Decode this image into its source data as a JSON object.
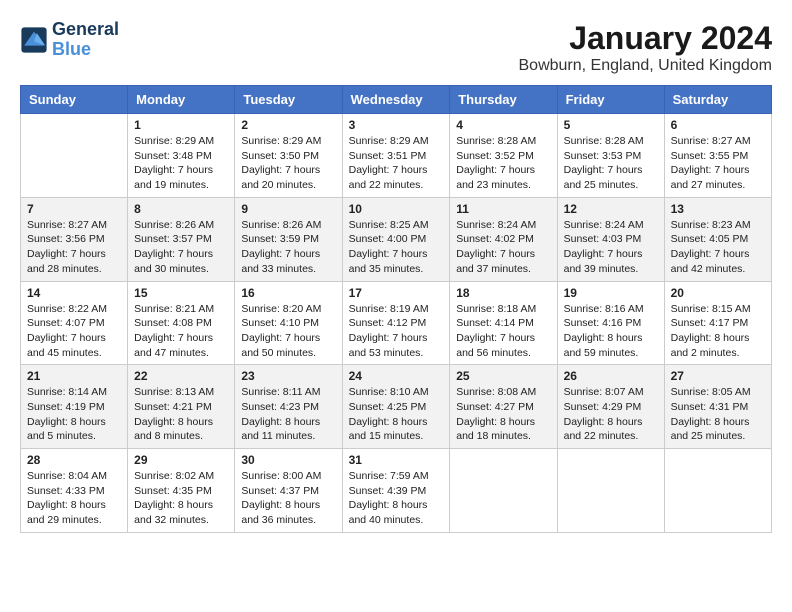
{
  "logo": {
    "line1": "General",
    "line2": "Blue"
  },
  "title": "January 2024",
  "subtitle": "Bowburn, England, United Kingdom",
  "header": {
    "days": [
      "Sunday",
      "Monday",
      "Tuesday",
      "Wednesday",
      "Thursday",
      "Friday",
      "Saturday"
    ]
  },
  "weeks": [
    [
      {
        "day": "",
        "info": ""
      },
      {
        "day": "1",
        "info": "Sunrise: 8:29 AM\nSunset: 3:48 PM\nDaylight: 7 hours\nand 19 minutes."
      },
      {
        "day": "2",
        "info": "Sunrise: 8:29 AM\nSunset: 3:50 PM\nDaylight: 7 hours\nand 20 minutes."
      },
      {
        "day": "3",
        "info": "Sunrise: 8:29 AM\nSunset: 3:51 PM\nDaylight: 7 hours\nand 22 minutes."
      },
      {
        "day": "4",
        "info": "Sunrise: 8:28 AM\nSunset: 3:52 PM\nDaylight: 7 hours\nand 23 minutes."
      },
      {
        "day": "5",
        "info": "Sunrise: 8:28 AM\nSunset: 3:53 PM\nDaylight: 7 hours\nand 25 minutes."
      },
      {
        "day": "6",
        "info": "Sunrise: 8:27 AM\nSunset: 3:55 PM\nDaylight: 7 hours\nand 27 minutes."
      }
    ],
    [
      {
        "day": "7",
        "info": "Sunrise: 8:27 AM\nSunset: 3:56 PM\nDaylight: 7 hours\nand 28 minutes."
      },
      {
        "day": "8",
        "info": "Sunrise: 8:26 AM\nSunset: 3:57 PM\nDaylight: 7 hours\nand 30 minutes."
      },
      {
        "day": "9",
        "info": "Sunrise: 8:26 AM\nSunset: 3:59 PM\nDaylight: 7 hours\nand 33 minutes."
      },
      {
        "day": "10",
        "info": "Sunrise: 8:25 AM\nSunset: 4:00 PM\nDaylight: 7 hours\nand 35 minutes."
      },
      {
        "day": "11",
        "info": "Sunrise: 8:24 AM\nSunset: 4:02 PM\nDaylight: 7 hours\nand 37 minutes."
      },
      {
        "day": "12",
        "info": "Sunrise: 8:24 AM\nSunset: 4:03 PM\nDaylight: 7 hours\nand 39 minutes."
      },
      {
        "day": "13",
        "info": "Sunrise: 8:23 AM\nSunset: 4:05 PM\nDaylight: 7 hours\nand 42 minutes."
      }
    ],
    [
      {
        "day": "14",
        "info": "Sunrise: 8:22 AM\nSunset: 4:07 PM\nDaylight: 7 hours\nand 45 minutes."
      },
      {
        "day": "15",
        "info": "Sunrise: 8:21 AM\nSunset: 4:08 PM\nDaylight: 7 hours\nand 47 minutes."
      },
      {
        "day": "16",
        "info": "Sunrise: 8:20 AM\nSunset: 4:10 PM\nDaylight: 7 hours\nand 50 minutes."
      },
      {
        "day": "17",
        "info": "Sunrise: 8:19 AM\nSunset: 4:12 PM\nDaylight: 7 hours\nand 53 minutes."
      },
      {
        "day": "18",
        "info": "Sunrise: 8:18 AM\nSunset: 4:14 PM\nDaylight: 7 hours\nand 56 minutes."
      },
      {
        "day": "19",
        "info": "Sunrise: 8:16 AM\nSunset: 4:16 PM\nDaylight: 8 hours\nand 59 minutes."
      },
      {
        "day": "20",
        "info": "Sunrise: 8:15 AM\nSunset: 4:17 PM\nDaylight: 8 hours\nand 2 minutes."
      }
    ],
    [
      {
        "day": "21",
        "info": "Sunrise: 8:14 AM\nSunset: 4:19 PM\nDaylight: 8 hours\nand 5 minutes."
      },
      {
        "day": "22",
        "info": "Sunrise: 8:13 AM\nSunset: 4:21 PM\nDaylight: 8 hours\nand 8 minutes."
      },
      {
        "day": "23",
        "info": "Sunrise: 8:11 AM\nSunset: 4:23 PM\nDaylight: 8 hours\nand 11 minutes."
      },
      {
        "day": "24",
        "info": "Sunrise: 8:10 AM\nSunset: 4:25 PM\nDaylight: 8 hours\nand 15 minutes."
      },
      {
        "day": "25",
        "info": "Sunrise: 8:08 AM\nSunset: 4:27 PM\nDaylight: 8 hours\nand 18 minutes."
      },
      {
        "day": "26",
        "info": "Sunrise: 8:07 AM\nSunset: 4:29 PM\nDaylight: 8 hours\nand 22 minutes."
      },
      {
        "day": "27",
        "info": "Sunrise: 8:05 AM\nSunset: 4:31 PM\nDaylight: 8 hours\nand 25 minutes."
      }
    ],
    [
      {
        "day": "28",
        "info": "Sunrise: 8:04 AM\nSunset: 4:33 PM\nDaylight: 8 hours\nand 29 minutes."
      },
      {
        "day": "29",
        "info": "Sunrise: 8:02 AM\nSunset: 4:35 PM\nDaylight: 8 hours\nand 32 minutes."
      },
      {
        "day": "30",
        "info": "Sunrise: 8:00 AM\nSunset: 4:37 PM\nDaylight: 8 hours\nand 36 minutes."
      },
      {
        "day": "31",
        "info": "Sunrise: 7:59 AM\nSunset: 4:39 PM\nDaylight: 8 hours\nand 40 minutes."
      },
      {
        "day": "",
        "info": ""
      },
      {
        "day": "",
        "info": ""
      },
      {
        "day": "",
        "info": ""
      }
    ]
  ]
}
